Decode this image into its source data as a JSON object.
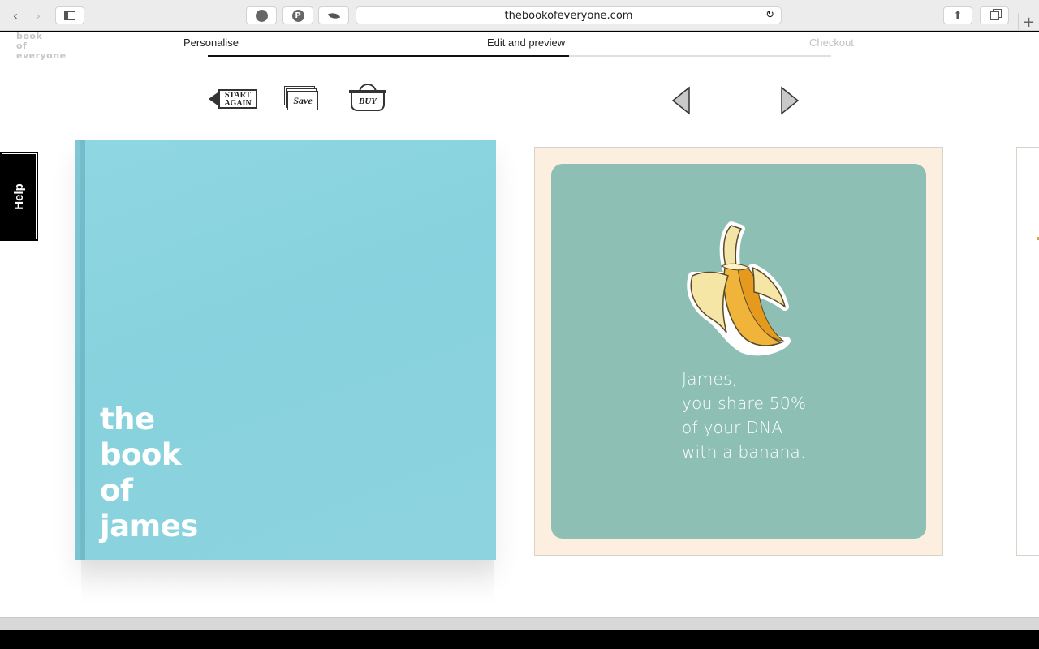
{
  "browser": {
    "url": "thebookofeveryone.com"
  },
  "site": {
    "logo_lines": [
      "book",
      "of",
      "everyone"
    ],
    "steps": [
      {
        "label": "Personalise",
        "state": "done"
      },
      {
        "label": "Edit and preview",
        "state": "current"
      },
      {
        "label": "Checkout",
        "state": "upcoming"
      }
    ],
    "progress_fraction": 0.58
  },
  "toolbar": {
    "start_again_label": [
      "START",
      "AGAIN"
    ],
    "save_label": "Save",
    "buy_label": "BUY"
  },
  "help": {
    "label": "Help"
  },
  "cover": {
    "title_lines": [
      "the",
      "book",
      "of",
      "james"
    ],
    "color": "#8dd4e0"
  },
  "page": {
    "text_lines": [
      "James,",
      "you share 50%",
      "of your DNA",
      "with a banana."
    ],
    "background": "#fcefe0",
    "panel_color": "#8ebfb5"
  },
  "icons": {
    "back": "chevron-left-icon",
    "forward": "chevron-right-icon",
    "sidebar": "sidebar-icon",
    "reload": "reload-icon",
    "share": "share-icon",
    "tabs": "tabs-icon",
    "new_tab": "plus-icon",
    "prev_page": "triangle-left-icon",
    "next_page": "triangle-right-icon"
  }
}
